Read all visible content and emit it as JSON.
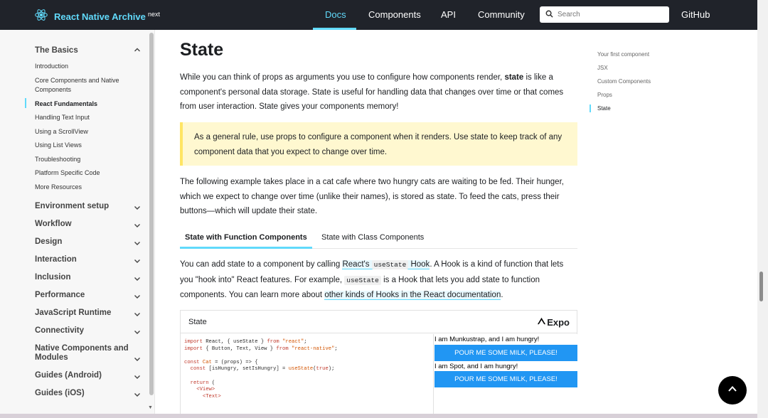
{
  "nav": {
    "brand": "React Native Archive",
    "version": "next",
    "links": [
      "Docs",
      "Components",
      "API",
      "Community"
    ],
    "search_placeholder": "Search",
    "github": "GitHub",
    "accent": "#61dafb"
  },
  "sidebar": {
    "basics_title": "The Basics",
    "items": [
      "Introduction",
      "Core Components and Native Components",
      "React Fundamentals",
      "Handling Text Input",
      "Using a ScrollView",
      "Using List Views",
      "Troubleshooting",
      "Platform Specific Code",
      "More Resources"
    ],
    "active_item": "React Fundamentals",
    "sections": [
      "Environment setup",
      "Workflow",
      "Design",
      "Interaction",
      "Inclusion",
      "Performance",
      "JavaScript Runtime",
      "Connectivity",
      "Native Components and Modules",
      "Guides (Android)",
      "Guides (iOS)"
    ]
  },
  "main": {
    "title": "State",
    "intro_a": "While you can think of props as arguments you use to configure how components render, ",
    "intro_bold": "state",
    "intro_b": " is like a component's personal data storage. State is useful for handling data that changes over time or that comes from user interaction. State gives your components memory!",
    "callout": "As a general rule, use props to configure a component when it renders. Use state to keep track of any component data that you expect to change over time.",
    "example_para": "The following example takes place in a cat cafe where two hungry cats are waiting to be fed. Their hunger, which we expect to change over time (unlike their names), is stored as state. To feed the cats, press their buttons—which will update their state.",
    "tabs": [
      "State with Function Components",
      "State with Class Components"
    ],
    "hook_1": "You can add state to a component by calling ",
    "hook_link_a": "React's ",
    "hook_code": "useState",
    "hook_link_b": " Hook",
    "hook_2": ". A Hook is a kind of function that lets you \"hook into\" React features. For example, ",
    "hook_code2": "useState",
    "hook_3": " is a Hook that lets you add state to function components. You can learn more about ",
    "hook_link2": "other kinds of Hooks in the React documentation",
    "hook_4": "."
  },
  "snack": {
    "title": "State",
    "brand": "Expo",
    "code_lines": [
      "import React, { useState } from \"react\";",
      "import { Button, Text, View } from \"react-native\";",
      "",
      "const Cat = (props) => {",
      "  const [isHungry, setIsHungry] = useState(true);",
      "",
      "  return (",
      "    <View>",
      "      <Text>"
    ],
    "preview": [
      {
        "text": "I am Munkustrap, and I am hungry!",
        "button": "POUR ME SOME MILK, PLEASE!"
      },
      {
        "text": "I am Spot, and I am hungry!",
        "button": "POUR ME SOME MILK, PLEASE!"
      }
    ]
  },
  "toc": {
    "items": [
      "Your first component",
      "JSX",
      "Custom Components",
      "Props",
      "State"
    ],
    "active": "State"
  }
}
